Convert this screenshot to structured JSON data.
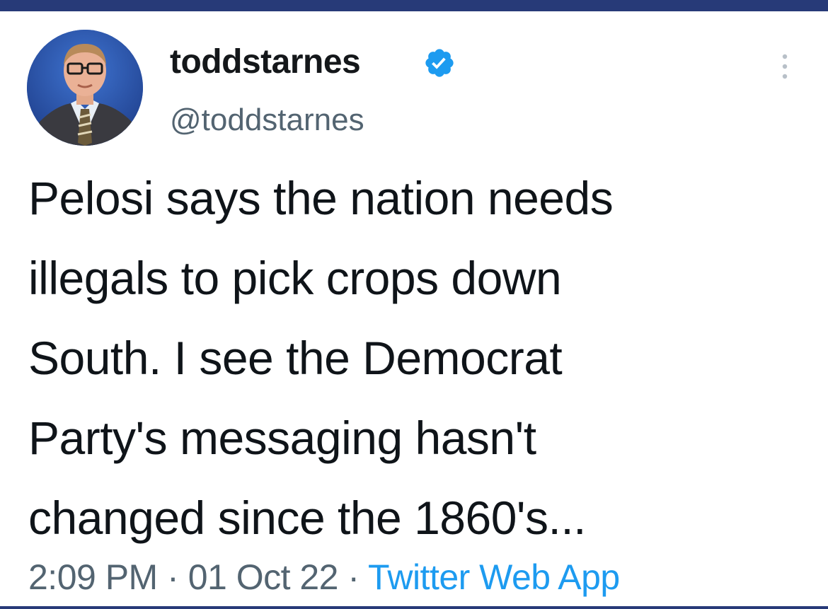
{
  "tweet": {
    "display_name": "toddstarnes",
    "handle": "@toddstarnes",
    "text_lines": [
      "Pelosi says the nation needs",
      "illegals to pick crops down",
      "South. I see the Democrat",
      "Party's messaging hasn't",
      "changed since the 1860's..."
    ],
    "time": "2:09 PM",
    "separator": "·",
    "date": "01 Oct 22",
    "source": "Twitter Web App"
  },
  "icons": {
    "verified": "verified-badge-icon",
    "more": "more-options-icon",
    "avatar": "profile-photo"
  },
  "colors": {
    "frame_border": "#273a78",
    "verified_blue": "#1d9bf0",
    "text_primary": "#0f1419",
    "text_secondary": "#536471",
    "link": "#1d9bf0"
  }
}
